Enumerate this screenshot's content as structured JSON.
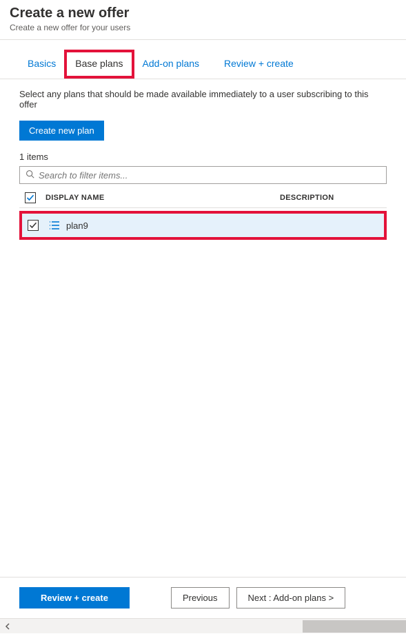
{
  "header": {
    "title": "Create a new offer",
    "subtitle": "Create a new offer for your users"
  },
  "tabs": [
    {
      "label": "Basics",
      "active": false
    },
    {
      "label": "Base plans",
      "active": true
    },
    {
      "label": "Add-on plans",
      "active": false
    },
    {
      "label": "Review + create",
      "active": false
    }
  ],
  "instruction": "Select any plans that should be made available immediately to a user subscribing to this offer",
  "create_button_label": "Create new plan",
  "item_count_label": "1 items",
  "search_placeholder": "Search to filter items...",
  "columns": {
    "name": "DISPLAY NAME",
    "description": "DESCRIPTION"
  },
  "rows": [
    {
      "name": "plan9",
      "description": "",
      "checked": true
    }
  ],
  "footer": {
    "review_label": "Review + create",
    "previous_label": "Previous",
    "next_label": "Next : Add-on plans >"
  }
}
